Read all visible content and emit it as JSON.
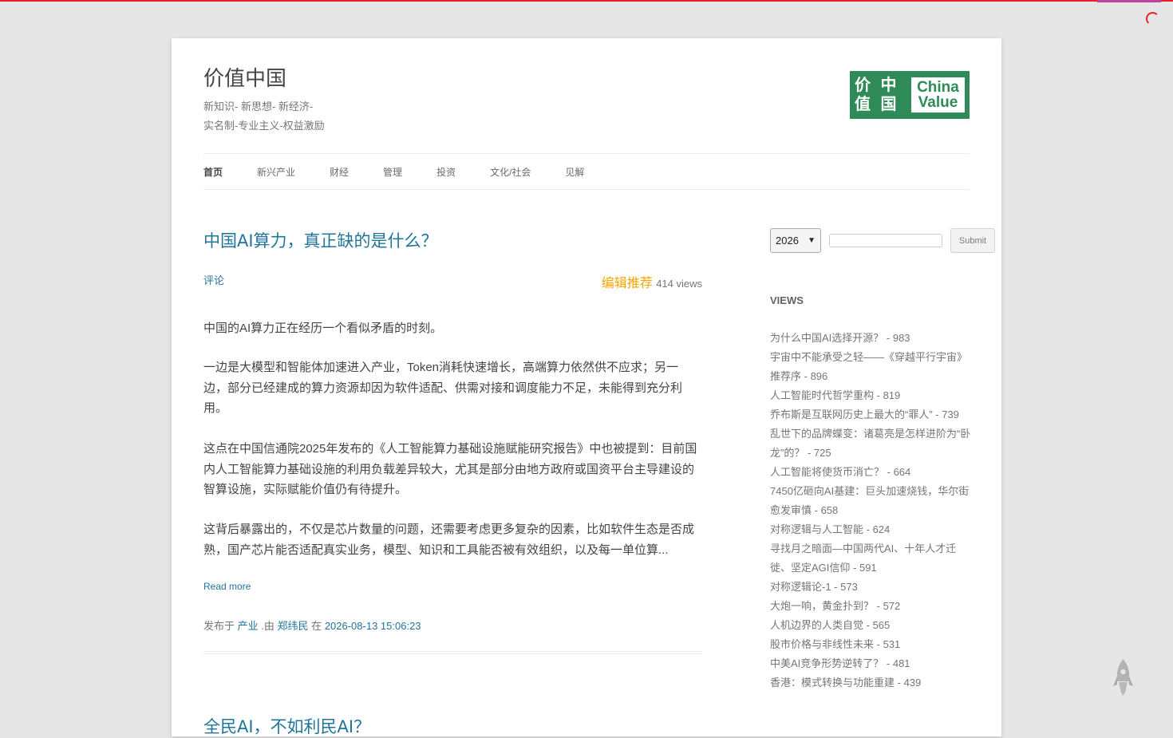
{
  "site": {
    "title": "价值中国",
    "tagline_1": "新知识- 新思想- 新经济-",
    "tagline_2": "实名制-专业主义-权益激励",
    "logo": {
      "cn_chars": [
        "价",
        "中",
        "值",
        "国"
      ],
      "en_lines": [
        "China",
        "Value"
      ],
      "color": "#2e8b57"
    }
  },
  "nav": {
    "items": [
      {
        "label": "首页",
        "current": true
      },
      {
        "label": "新兴产业"
      },
      {
        "label": "财经"
      },
      {
        "label": "管理"
      },
      {
        "label": "投资"
      },
      {
        "label": "文化/社会"
      },
      {
        "label": "见解"
      }
    ]
  },
  "posts": [
    {
      "title": "中国AI算力，真正缺的是什么？",
      "comments_label": "评论",
      "badge": "编辑推荐",
      "views": "414 views",
      "paragraphs": [
        "中国的AI算力正在经历一个看似矛盾的时刻。",
        "一边是大模型和智能体加速进入产业，Token消耗快速增长，高端算力依然供不应求；另一边，部分已经建成的算力资源却因为软件适配、供需对接和调度能力不足，未能得到充分利用。",
        "这点在中国信通院2025年发布的《人工智能算力基础设施赋能研究报告》中也被提到：目前国内人工智能算力基础设施的利用负载差异较大，尤其是部分由地方政府或国资平台主导建设的智算设施，实际赋能价值仍有待提升。",
        "这背后暴露出的，不仅是芯片数量的问题，还需要考虑更多复杂的因素，比如软件生态是否成熟，国产芯片能否适配真实业务，模型、知识和工具能否被有效组织，以及每一单位算..."
      ],
      "read_more": "Read more",
      "footer": {
        "prefix": "发布于",
        "category": "产业",
        "by": ".由",
        "author": "郑纬民",
        "at": "在",
        "datetime": "2026-08-13 15:06:23"
      }
    },
    {
      "title": "全民AI，不如利民AI？"
    }
  ],
  "sidebar": {
    "year_select": "2026",
    "search_placeholder": "",
    "submit_label": "Submit",
    "views_heading": "VIEWS",
    "views": [
      {
        "title": "为什么中国AI选择开源？",
        "count": " - 983"
      },
      {
        "title": "宇宙中不能承受之轻——《穿越平行宇宙》推荐序",
        "count": " - 896"
      },
      {
        "title": "人工智能时代哲学重构",
        "count": " - 819"
      },
      {
        "title": "乔布斯是互联网历史上最大的“罪人”",
        "count": " - 739"
      },
      {
        "title": "乱世下的品牌蝶变：诸葛亮是怎样进阶为“卧龙”的？",
        "count": " - 725"
      },
      {
        "title": "人工智能将使货币消亡？",
        "count": " - 664"
      },
      {
        "title": "7450亿砸向AI基建：巨头加速烧钱，华尔街愈发审慎",
        "count": " - 658"
      },
      {
        "title": "对称逻辑与人工智能",
        "count": " - 624"
      },
      {
        "title": "寻找月之暗面—中国两代AI、十年人才迁徙、坚定AGI信仰",
        "count": " - 591"
      },
      {
        "title": "对称逻辑论-1",
        "count": " - 573"
      },
      {
        "title": "大炮一响，黄金扑到？",
        "count": " - 572"
      },
      {
        "title": "人机边界的人类自觉",
        "count": " - 565"
      },
      {
        "title": "股市价格与非线性未来",
        "count": " - 531"
      },
      {
        "title": "中美AI竞争形势逆转了？",
        "count": " - 481"
      },
      {
        "title": "香港：模式转换与功能重建",
        "count": " - 439"
      }
    ]
  },
  "colors": {
    "link": "#21759b",
    "badge": "#f0a500",
    "top_bar": "#e8202c"
  }
}
